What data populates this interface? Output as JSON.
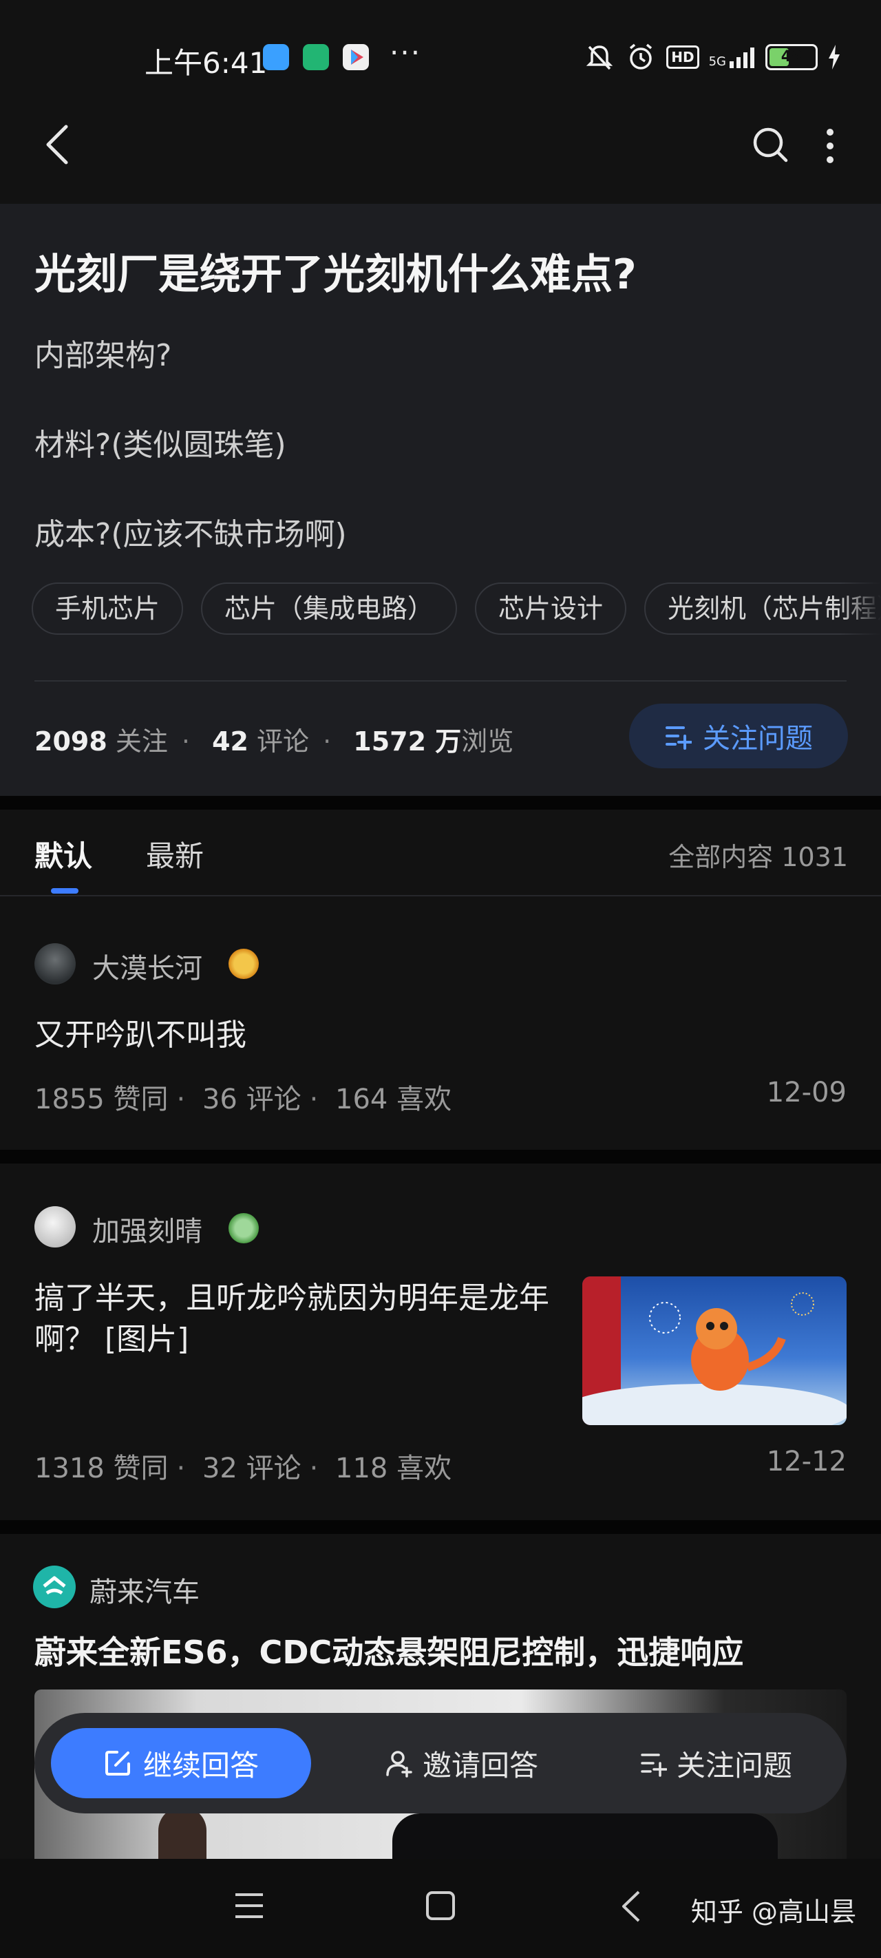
{
  "status_bar": {
    "time": "上午6:41",
    "more_dots": "···",
    "hd_label": "HD",
    "network_label": "5G",
    "battery_level": "49",
    "battery_fraction": 0.49
  },
  "question": {
    "title": "光刻厂是绕开了光刻机什么难点?",
    "lines": [
      "内部架构?",
      "材料?(类似圆珠笔)",
      "成本?(应该不缺市场啊)"
    ],
    "topics": [
      "手机芯片",
      "芯片（集成电路）",
      "芯片设计",
      "光刻机（芯片制程）"
    ],
    "followers_count": "2098",
    "followers_label": "关注",
    "comments_count": "42",
    "comments_label": "评论",
    "views_count": "1572 万",
    "views_label": "浏览",
    "follow_button_label": "关注问题"
  },
  "tabs": {
    "default_label": "默认",
    "latest_label": "最新",
    "total_label": "全部内容 1031"
  },
  "answers": [
    {
      "author": "大漠长河",
      "text": "又开吟趴不叫我",
      "likes": "1855",
      "likes_label": "赞同",
      "comments": "36",
      "comments_label": "评论",
      "favorites": "164",
      "favorites_label": "喜欢",
      "date": "12-09"
    },
    {
      "author": "加强刻晴",
      "text": "搞了半天，且听龙吟就因为明年是龙年啊？ [图片]",
      "likes": "1318",
      "likes_label": "赞同",
      "comments": "32",
      "comments_label": "评论",
      "favorites": "118",
      "favorites_label": "喜欢",
      "date": "12-12"
    }
  ],
  "ad": {
    "brand": "蔚来汽车",
    "title": "蔚来全新ES6，CDC动态悬架阻尼控制，迅捷响应"
  },
  "bottom_actions": {
    "continue_label": "继续回答",
    "invite_label": "邀请回答",
    "follow_label": "关注问题"
  },
  "watermark": "知乎 @高山昙",
  "colors": {
    "accent": "#3d7cff",
    "background": "#121212",
    "card": "#1d1e22"
  },
  "icons": [
    "back-arrow-icon",
    "search-icon",
    "more-vertical-icon",
    "follow-list-icon",
    "edit-icon",
    "person-icon",
    "menu-icon",
    "home-square-icon",
    "back-chevron-icon"
  ]
}
